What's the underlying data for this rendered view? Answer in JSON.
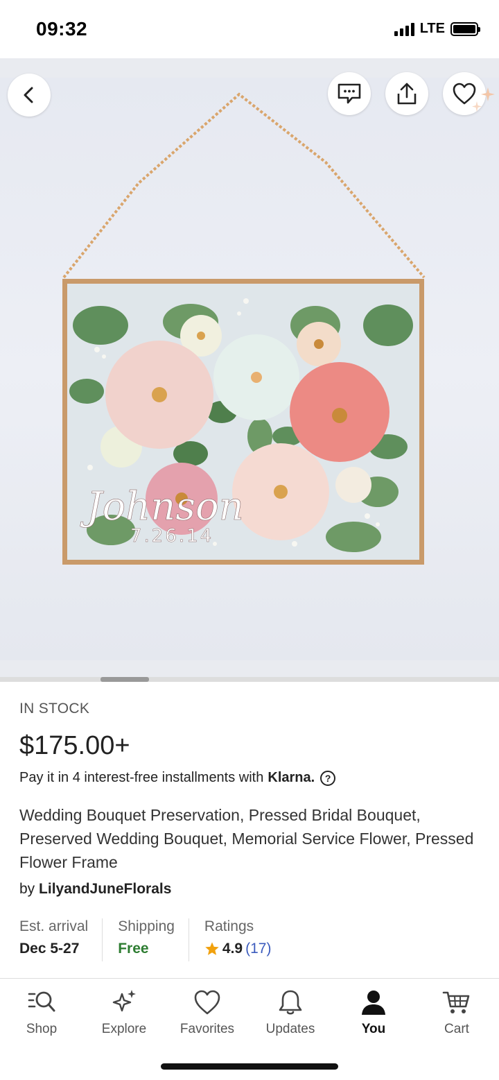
{
  "status": {
    "time": "09:32",
    "network": "LTE"
  },
  "product": {
    "stock": "IN STOCK",
    "price": "$175.00+",
    "klarna_text": "Pay it in 4 interest-free installments with",
    "klarna_brand": "Klarna.",
    "title": "Wedding Bouquet Preservation, Pressed Bridal Bouquet, Preserved Wedding Bouquet, Memorial Service Flower, Pressed Flower Frame",
    "seller_prefix": "by",
    "seller": "LilyandJuneFlorals",
    "image_text_name": "Johnson",
    "image_text_date": "7.26.14"
  },
  "meta": {
    "arrival_label": "Est. arrival",
    "arrival_value": "Dec 5-27",
    "shipping_label": "Shipping",
    "shipping_value": "Free",
    "ratings_label": "Ratings",
    "rating_value": "4.9",
    "rating_count": "(17)"
  },
  "tabs": [
    {
      "label": "Shop",
      "icon": "shop-search-icon"
    },
    {
      "label": "Explore",
      "icon": "sparkle-icon"
    },
    {
      "label": "Favorites",
      "icon": "heart-icon"
    },
    {
      "label": "Updates",
      "icon": "bell-icon"
    },
    {
      "label": "You",
      "icon": "person-icon",
      "active": true
    },
    {
      "label": "Cart",
      "icon": "cart-icon"
    }
  ],
  "colors": {
    "accent_rating_star": "#f1a10d",
    "shipping_free": "#2e7d32",
    "rating_count": "#3b5bbd"
  }
}
